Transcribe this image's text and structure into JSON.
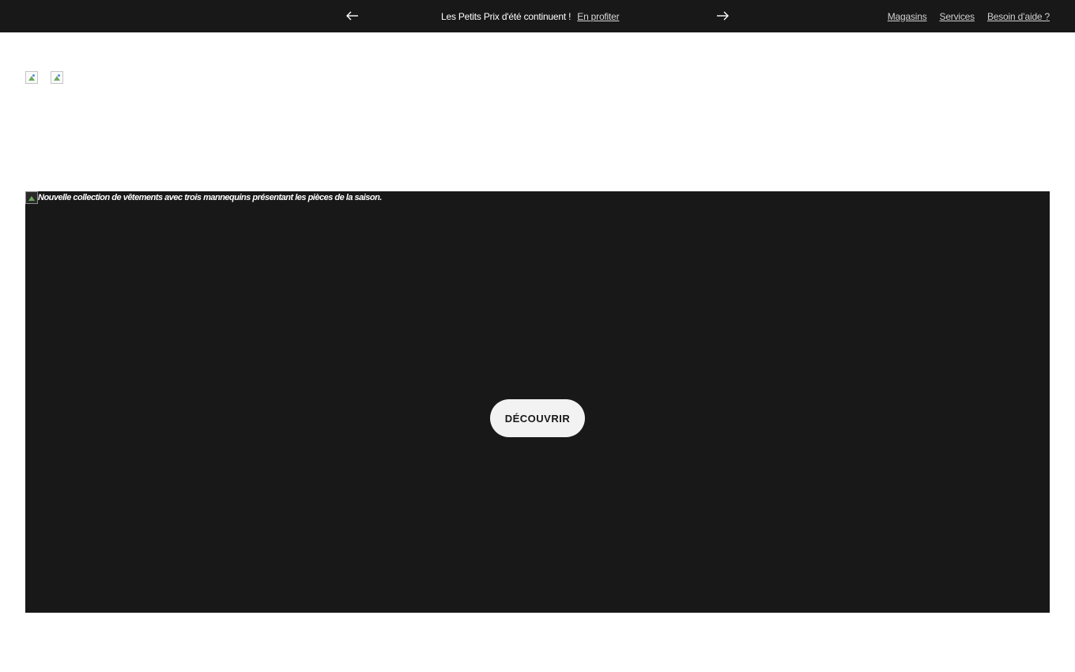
{
  "topbar": {
    "promo_text": "Les Petits Prix d'été continuent !",
    "promo_link": "En profiter",
    "prev_icon": "arrow-left-icon",
    "next_icon": "arrow-right-icon",
    "utility_links": [
      "Magasins",
      "Services",
      "Besoin d’aide ?"
    ]
  },
  "header": {
    "logo_images": [
      "broken-image-icon",
      "broken-image-icon"
    ]
  },
  "hero": {
    "image_alt": "Nouvelle collection de vêtements avec trois mannequins présentant les pièces de la saison.",
    "cta_label": "DÉCOUVRIR"
  },
  "colors": {
    "topbar_bg": "#181818",
    "hero_bg": "#181818",
    "cta_bg": "#f2f2f2",
    "page_bg": "#ffffff"
  }
}
